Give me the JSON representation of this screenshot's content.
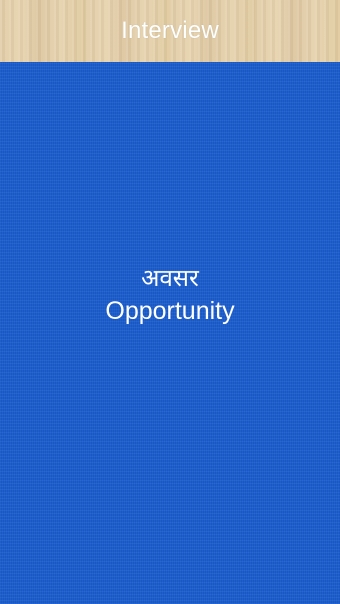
{
  "header": {
    "title": "Interview"
  },
  "card": {
    "hindi": "अवसर",
    "english": "Opportunity"
  },
  "colors": {
    "card_background": "#1a5ccf",
    "header_background": "#e3cea8",
    "text": "#ffffff"
  }
}
